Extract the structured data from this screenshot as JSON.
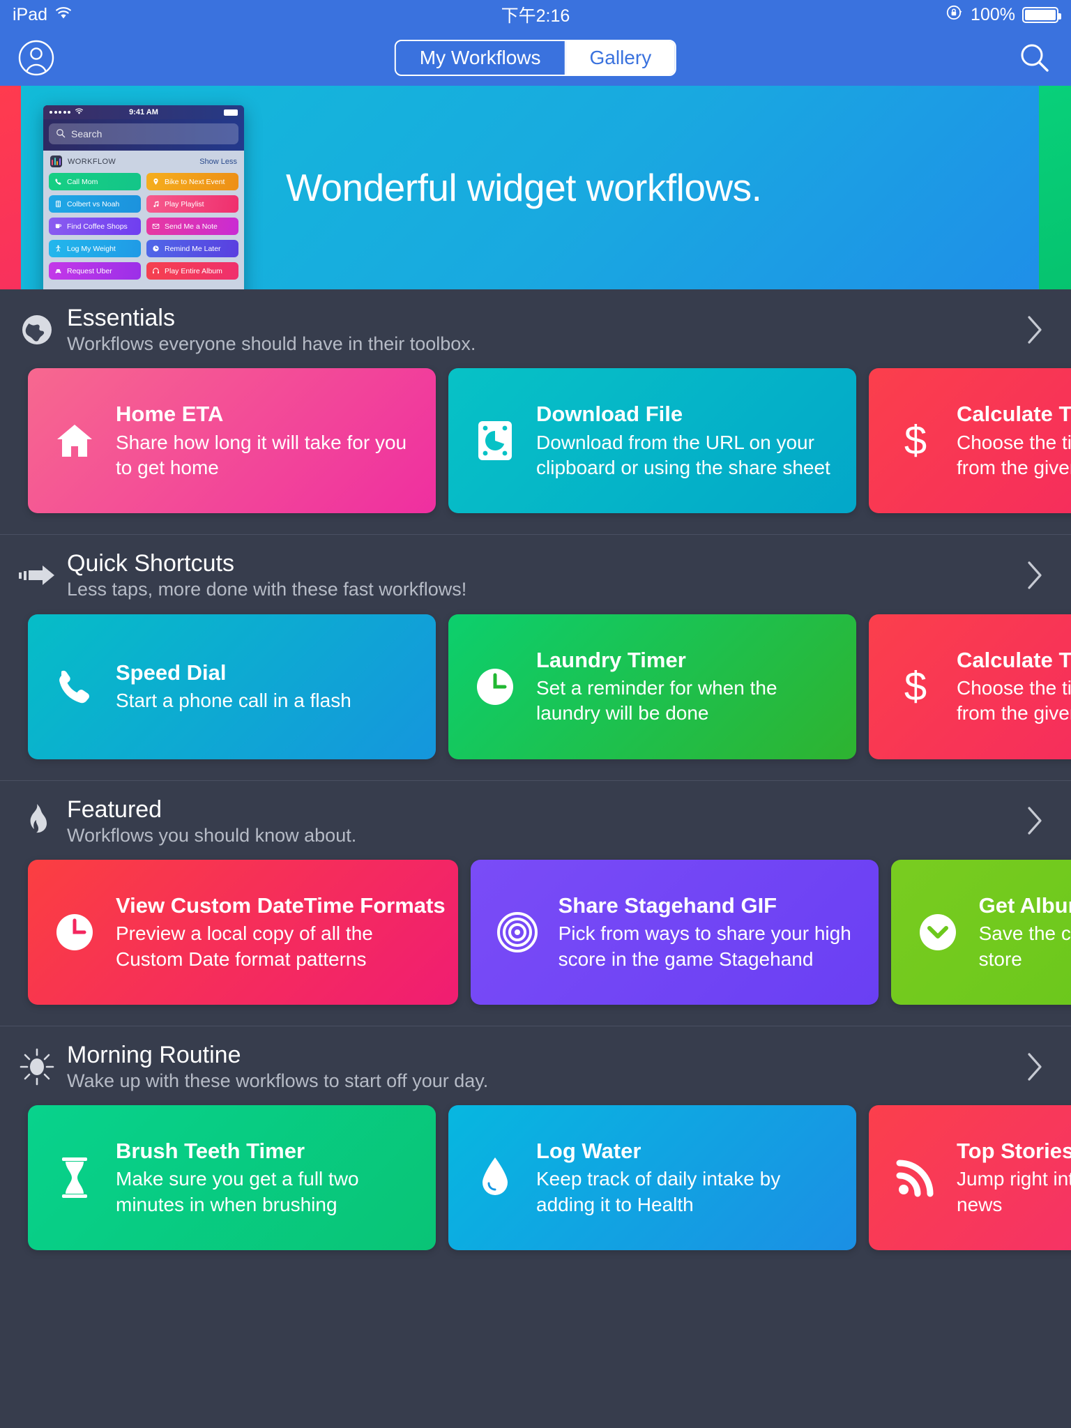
{
  "statusbar": {
    "device": "iPad",
    "wifi_icon": "wifi-icon",
    "time": "下午2:16",
    "rotation_lock_icon": "rotation-lock-icon",
    "battery_percent": "100%",
    "battery_icon": "battery-full-icon"
  },
  "navbar": {
    "account_icon": "account-avatar-icon",
    "search_icon": "search-icon",
    "tabs": [
      {
        "label": "My Workflows",
        "active": false
      },
      {
        "label": "Gallery",
        "active": true
      }
    ]
  },
  "hero": {
    "title": "Wonderful widget workflows.",
    "phone_mock": {
      "signal_icon": "signal-dots-icon",
      "wifi_icon": "wifi-icon",
      "time": "9:41 AM",
      "battery_icon": "battery-icon",
      "search_placeholder": "Search",
      "search_icon": "search-icon",
      "widget_name": "WORKFLOW",
      "show_less_label": "Show Less",
      "shortcuts": [
        {
          "label": "Call Mom",
          "icon": "phone-icon",
          "color": "#18cc7f"
        },
        {
          "label": "Bike to Next Event",
          "icon": "location-pin-icon",
          "color": "#f0a31b"
        },
        {
          "label": "Colbert vs Noah",
          "icon": "film-icon",
          "color": "#1c9fe0"
        },
        {
          "label": "Play Playlist",
          "icon": "music-note-icon",
          "color": "#f2487f"
        },
        {
          "label": "Find Coffee Shops",
          "icon": "coffee-cup-icon",
          "color": "#7a4ae8"
        },
        {
          "label": "Send Me a Note",
          "icon": "envelope-icon",
          "color": "#d12bc7"
        },
        {
          "label": "Log My Weight",
          "icon": "person-icon",
          "color": "#1eb0e8"
        },
        {
          "label": "Remind Me Later",
          "icon": "clock-icon",
          "color": "#4a5de0"
        },
        {
          "label": "Request Uber",
          "icon": "car-icon",
          "color": "#b530e8"
        },
        {
          "label": "Play Entire Album",
          "icon": "headphones-icon",
          "color": "#f53b4e"
        }
      ]
    }
  },
  "sections": [
    {
      "id": "essentials",
      "icon": "globe-icon",
      "title": "Essentials",
      "subtitle": "Workflows everyone should have in their toolbox.",
      "chevron_icon": "chevron-right-icon",
      "cards": [
        {
          "title": "Home ETA",
          "desc": "Share how long it will take for you to get home",
          "icon": "home-icon",
          "style": "g-home"
        },
        {
          "title": "Download File",
          "desc": "Download from the URL on your clipboard or using the share sheet",
          "icon": "download-file-icon",
          "style": "g-download"
        },
        {
          "title": "Calculate Tip",
          "desc": "Choose the tip and split the bill from the given amount",
          "icon": "dollar-sign-icon",
          "style": "g-tip"
        }
      ]
    },
    {
      "id": "quick-shortcuts",
      "icon": "fast-arrow-icon",
      "title": "Quick Shortcuts",
      "subtitle": "Less taps, more done with these fast workflows!",
      "chevron_icon": "chevron-right-icon",
      "cards": [
        {
          "title": "Speed Dial",
          "desc": "Start a phone call in a flash",
          "icon": "phone-icon",
          "style": "g-speed"
        },
        {
          "title": "Laundry Timer",
          "desc": "Set a reminder for when the laundry will be done",
          "icon": "clock-icon",
          "style": "g-laundry"
        },
        {
          "title": "Calculate Tip",
          "desc": "Choose the tip and split the bill from the given amount",
          "icon": "dollar-sign-icon",
          "style": "g-tip"
        }
      ]
    },
    {
      "id": "featured",
      "icon": "flame-icon",
      "title": "Featured",
      "subtitle": "Workflows you should know about.",
      "chevron_icon": "chevron-right-icon",
      "cards": [
        {
          "title": "View Custom DateTime Formats",
          "desc": "Preview a local copy of all the Custom Date format patterns",
          "icon": "clock-icon",
          "style": "g-datetime"
        },
        {
          "title": "Share Stagehand GIF",
          "desc": "Pick from ways to share your high score in the game Stagehand",
          "icon": "target-rings-icon",
          "style": "g-stage"
        },
        {
          "title": "Get Album Artwork",
          "desc": "Save the cover art by searching the store",
          "icon": "chevron-down-circle-icon",
          "style": "g-album"
        }
      ]
    },
    {
      "id": "morning-routine",
      "icon": "sun-icon",
      "title": "Morning Routine",
      "subtitle": "Wake up with these workflows to start off your day.",
      "chevron_icon": "chevron-right-icon",
      "cards": [
        {
          "title": "Brush Teeth Timer",
          "desc": "Make sure you get a full two minutes in when brushing",
          "icon": "hourglass-icon",
          "style": "g-brush"
        },
        {
          "title": "Log Water",
          "desc": "Keep track of daily intake by adding it to Health",
          "icon": "water-drop-icon",
          "style": "g-water"
        },
        {
          "title": "Top Stories Today",
          "desc": "Jump right into the most important news",
          "icon": "rss-icon",
          "style": "g-news"
        }
      ]
    }
  ],
  "colors": {
    "nav_blue": "#3a72de",
    "page_bg": "#373d4d",
    "divider": "#4a5062"
  }
}
